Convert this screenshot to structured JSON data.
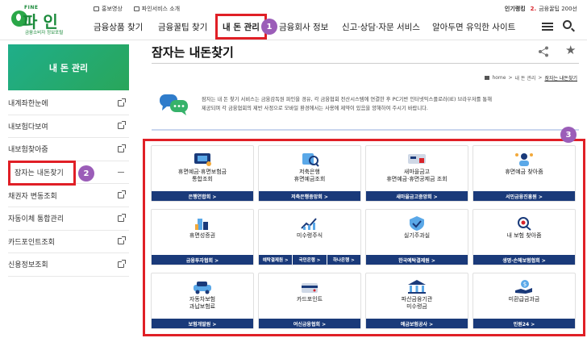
{
  "logo": {
    "fine": "FINE",
    "name": "파 인",
    "sub": "금융소비자 정보포털"
  },
  "util": {
    "promo_video": "홍보영상",
    "service_intro": "파인서비스 소개"
  },
  "popular": {
    "label": "인기랭킹",
    "rank": "2.",
    "term": "금융꿀팁 200선"
  },
  "nav": {
    "items": [
      "금융상품 찾기",
      "금융꿀팁 찾기",
      "내 돈 관리",
      "금융회사 정보",
      "신고·상담·자문 서비스",
      "알아두면 유익한 사이트"
    ]
  },
  "badges": [
    "1",
    "2",
    "3"
  ],
  "sidebar": {
    "title": "내 돈 관리",
    "items": [
      "내계좌한눈에",
      "내보험다보여",
      "내보험찾아줌",
      "잠자는 내돈찾기",
      "채권자 변동조회",
      "자동이체 통합관리",
      "카드포인트조회",
      "신용정보조회"
    ]
  },
  "page": {
    "title": "잠자는 내돈찾기",
    "breadcrumb": {
      "home": "home",
      "sep": ">",
      "level1": "내 돈 관리",
      "current": "잠자는 내돈찾기"
    },
    "intro_line1": "잠자는 내 돈 찾기 서비스는 금융감독원 파인을 경유, 각 금융협회 전산시스템에 연결한 후 PC기반 인터넷익스플로러(IE) 브라우저를 통해",
    "intro_line2": "제공되며 각 금융협회의 제반 사정으로 모바일 환경에서는 사용에 제약이 있음을 양해하여 주시기 바랍니다."
  },
  "cards": [
    {
      "label": [
        "휴면예금·휴면보험금",
        "통합조회"
      ],
      "buttons": [
        "은행연합회 >"
      ]
    },
    {
      "label": [
        "저축은행",
        "휴면예금조회"
      ],
      "buttons": [
        "저축은행중앙회 >"
      ]
    },
    {
      "label": [
        "새마을금고",
        "휴면예금·휴면공제금 조회"
      ],
      "buttons": [
        "새마을금고중앙회 >"
      ]
    },
    {
      "label": [
        "휴면예금 찾아줌"
      ],
      "buttons": [
        "서민금융진흥원 >"
      ]
    },
    {
      "label": [
        "휴면성증권"
      ],
      "buttons": [
        "금융투자협회 >"
      ]
    },
    {
      "label": [
        "미수령주식"
      ],
      "buttons": [
        "예탁결제원 >",
        "국민은행 >",
        "하나은행 >"
      ]
    },
    {
      "label": [
        "실기주과실"
      ],
      "buttons": [
        "한국예탁결제원 >"
      ]
    },
    {
      "label": [
        "내 보험 찾아줌"
      ],
      "buttons": [
        "생명·손해보험협회 >"
      ]
    },
    {
      "label": [
        "자동차보험",
        "과납보험료"
      ],
      "buttons": [
        "보험개발원 >"
      ]
    },
    {
      "label": [
        "카드포인트"
      ],
      "buttons": [
        "여신금융협회 >"
      ]
    },
    {
      "label": [
        "파산금융기관",
        "미수령금"
      ],
      "buttons": [
        "예금보험공사 >"
      ]
    },
    {
      "label": [
        "미환급금과금"
      ],
      "buttons": [
        "민원24 >"
      ]
    }
  ],
  "colors": {
    "accent": "#1a3a7a",
    "green": "#2aa748",
    "highlight": "#e01f26",
    "badge": "#9b5db8"
  }
}
